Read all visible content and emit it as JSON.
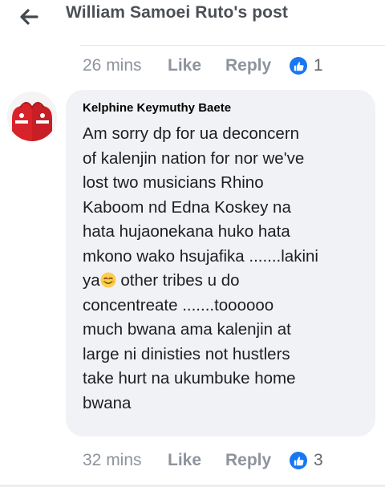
{
  "header": {
    "title": "William Samoei Ruto's post"
  },
  "previous_comment": {
    "time": "26 mins",
    "like_label": "Like",
    "reply_label": "Reply",
    "reaction_count": "1"
  },
  "comment": {
    "author": "Kelphine Keymuthy Baete",
    "text_part1": "Am sorry dp for ua deconcern\nof kalenjin nation for nor we've\nlost two musicians Rhino\nKaboom nd Edna Koskey na\nhata hujaonekana huko hata\nmkono wako hsujafika .......lakini\nya",
    "text_part2": " other tribes u do\nconcentreate .......toooooo\nmuch bwana ama kalenjin at\nlarge ni dinisties not hustlers\ntake hurt na ukumbuke home\nbwana",
    "emoji": "smiling-face-with-smiling-eyes-emoji",
    "time": "32 mins",
    "like_label": "Like",
    "reply_label": "Reply",
    "reaction_count": "3"
  },
  "colors": {
    "like_blue": "#1877f2",
    "bubble_bg": "#f0f2f5",
    "meta_gray": "#8d949e"
  }
}
